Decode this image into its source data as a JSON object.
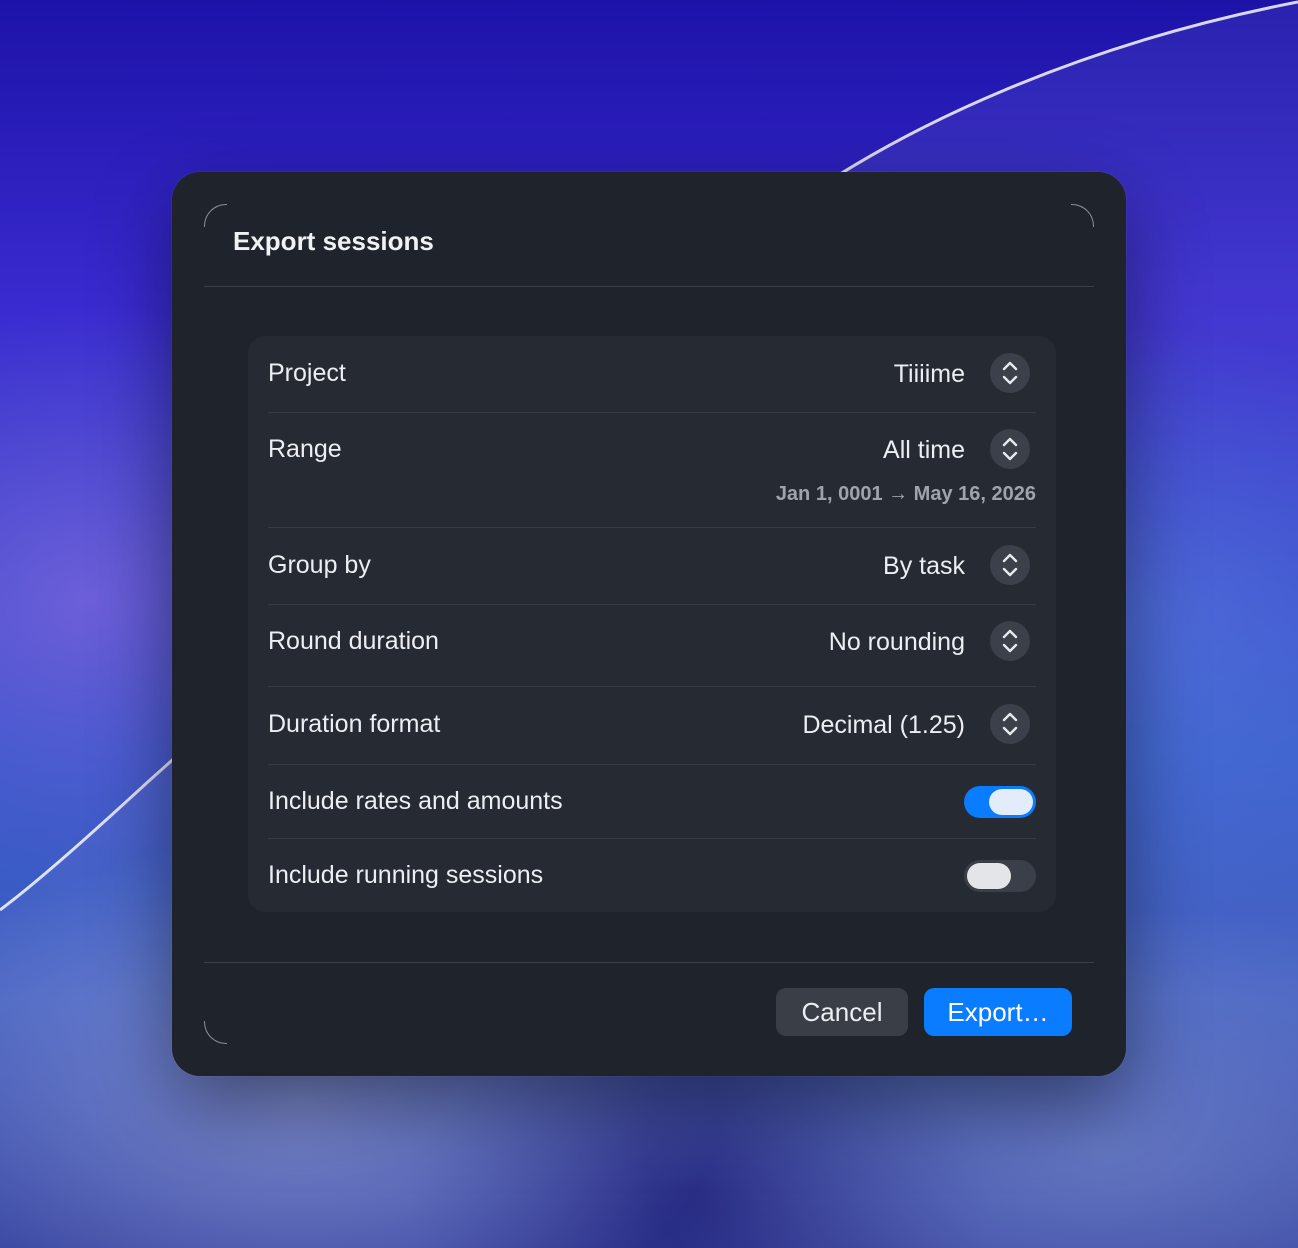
{
  "dialog": {
    "title": "Export sessions"
  },
  "form": {
    "project": {
      "label": "Project",
      "value": "Tiiiime"
    },
    "range": {
      "label": "Range",
      "value": "All time",
      "subtext": "Jan 1, 0001 → May 16, 2026"
    },
    "group_by": {
      "label": "Group by",
      "value": "By task"
    },
    "round_duration": {
      "label": "Round duration",
      "value": "No rounding"
    },
    "duration_format": {
      "label": "Duration format",
      "value": "Decimal (1.25)"
    },
    "include_rates": {
      "label": "Include rates and amounts",
      "enabled": true
    },
    "include_running": {
      "label": "Include running sessions",
      "enabled": false
    }
  },
  "buttons": {
    "cancel_label": "Cancel",
    "export_label": "Export…"
  },
  "icons": {
    "stepper": "chevron-up-down-icon"
  },
  "colors": {
    "accent": "#0a7cff",
    "dialog_bg": "#1f232c",
    "form_bg": "#262a33"
  }
}
